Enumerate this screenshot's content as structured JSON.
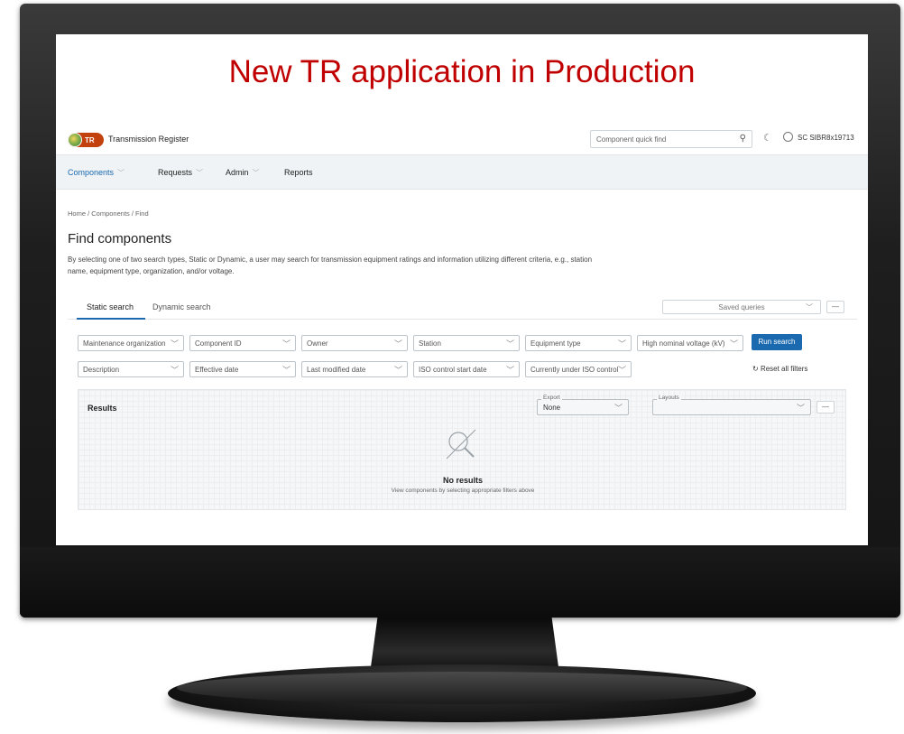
{
  "headline": "New TR application in Production",
  "app": {
    "logo_text": "TR",
    "title": "Transmission Register",
    "quickfind_placeholder": "Component quick find",
    "user_id": "SC SIBR8x19713"
  },
  "nav": [
    {
      "label": "Components",
      "active": true,
      "has_menu": true
    },
    {
      "label": "Requests",
      "active": false,
      "has_menu": true
    },
    {
      "label": "Admin",
      "active": false,
      "has_menu": true
    },
    {
      "label": "Reports",
      "active": false,
      "has_menu": false
    }
  ],
  "breadcrumb": "Home / Components / Find",
  "page": {
    "title": "Find components",
    "description": "By selecting one of two search types, Static or Dynamic, a user may search for transmission equipment ratings and information utilizing different criteria, e.g., station name, equipment type, organization, and/or voltage."
  },
  "tabs": [
    "Static search",
    "Dynamic search"
  ],
  "saved_queries": "Saved queries",
  "more_label": "—",
  "filters_row1": [
    "Maintenance organization",
    "Component ID",
    "Owner",
    "Station",
    "Equipment type",
    "High nominal voltage (kV)"
  ],
  "filters_row2": [
    "Description",
    "Effective date",
    "Last modified date",
    "ISO control start date",
    "Currently under ISO control"
  ],
  "run_search": "Run search",
  "reset_filters": "Reset all filters",
  "results": {
    "title": "Results",
    "export_legend": "Export",
    "export_value": "None",
    "layouts_legend": "Layouts",
    "empty_title": "No results",
    "empty_sub": "View components by selecting appropriate filters above"
  },
  "colors": {
    "headline": "#c00000",
    "accent": "#1b6ab0",
    "logo": "#c2410c"
  }
}
